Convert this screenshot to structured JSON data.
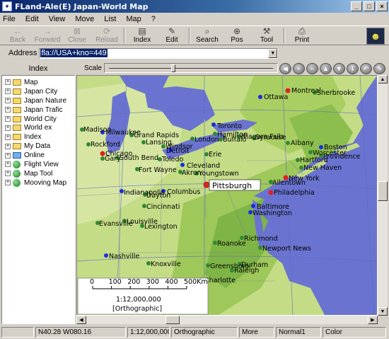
{
  "window": {
    "title": "FLand-Ale(E) Japan-World Map",
    "buttons": [
      "_",
      "□",
      "×"
    ]
  },
  "menu": [
    "File",
    "Edit",
    "View",
    "Move",
    "List",
    "Map",
    "?"
  ],
  "toolbar": [
    {
      "label": "Back",
      "icon": "back-arrow-icon",
      "enabled": false
    },
    {
      "label": "Forward",
      "icon": "forward-arrow-icon",
      "enabled": false
    },
    {
      "label": "Close",
      "icon": "close-icon",
      "enabled": false
    },
    {
      "label": "Reload",
      "icon": "reload-icon",
      "enabled": false
    },
    {
      "label": "Index",
      "icon": "index-icon",
      "enabled": true
    },
    {
      "label": "Edit",
      "icon": "edit-icon",
      "enabled": true
    },
    {
      "label": "Search",
      "icon": "search-icon",
      "enabled": true
    },
    {
      "label": "Pos",
      "icon": "position-icon",
      "enabled": true
    },
    {
      "label": "Tool",
      "icon": "tool-icon",
      "enabled": true
    },
    {
      "label": "Print",
      "icon": "print-icon",
      "enabled": true
    }
  ],
  "address": {
    "label": "Address",
    "value": "fla://USA+kno=449"
  },
  "index": {
    "header": "Index",
    "items": [
      {
        "label": "Map",
        "type": "folder"
      },
      {
        "label": "Japan City",
        "type": "folder"
      },
      {
        "label": "Japan Nature",
        "type": "folder"
      },
      {
        "label": "Japan Trafic",
        "type": "folder"
      },
      {
        "label": "World City",
        "type": "folder"
      },
      {
        "label": "World ex",
        "type": "folder"
      },
      {
        "label": "Index",
        "type": "folder"
      },
      {
        "label": "My Data",
        "type": "folder"
      },
      {
        "label": "Online",
        "type": "folder-blue"
      },
      {
        "label": "Flight View",
        "type": "globe"
      },
      {
        "label": "Map Tool",
        "type": "globe"
      },
      {
        "label": "Mooving Map",
        "type": "globe"
      }
    ]
  },
  "scale": {
    "label": "Scale",
    "level": 0.4
  },
  "nav_buttons": [
    "◀",
    "+",
    "–",
    "▲",
    "▼",
    "↧",
    "↶",
    "✎"
  ],
  "map": {
    "selected_city": "Pittsburgh",
    "scale_bar": {
      "ticks": [
        "0",
        "100",
        "200",
        "300",
        "400",
        "500Km"
      ],
      "ratio": "1:12,000,000",
      "projection": "[Orthographic]"
    },
    "cities_red": [
      "Montreal",
      "Chicago",
      "Philadelphia",
      "New York"
    ],
    "cities_blue": [
      "Ottawa",
      "Toronto",
      "Cleveland",
      "Columbus",
      "Indianapolis",
      "Baltimore",
      "Washington",
      "Nashville",
      "Boston",
      "Detroit",
      "Milwaukee"
    ],
    "cities_green": [
      "Sherbrooke",
      "Hamilton",
      "Buffalo",
      "Niagara Falls",
      "Syracuse",
      "Albany",
      "Worcester",
      "Providence",
      "Hartford",
      "New Haven",
      "Allentown",
      "Madison",
      "Rockford",
      "Grand Rapids",
      "Lansing",
      "Gary",
      "South Bend",
      "Windsor",
      "Toledo",
      "Fort Wayne",
      "Akron",
      "Youngstown",
      "London",
      "Erie",
      "Cincinnati",
      "Dayton",
      "Evansville",
      "Louisville",
      "Lexington",
      "Roanoke",
      "Richmond",
      "Newport News",
      "Knoxville",
      "Greensboro",
      "Raleigh",
      "Durham",
      "Charlotte"
    ]
  },
  "status": {
    "coords": "N40.28 W080.16",
    "ratio": "1:12,000,000",
    "projection": "Orthographic",
    "more": "More",
    "mode": "Normal1",
    "color": "Color"
  },
  "colors": {
    "land_light": "#d8e6a0",
    "land_mid": "#b6d46e",
    "land_dark": "#8fbe4e",
    "water": "#6a74d0",
    "city_red": "#e02020",
    "city_blue": "#1a2ce0",
    "city_green": "#2f8a2f"
  }
}
